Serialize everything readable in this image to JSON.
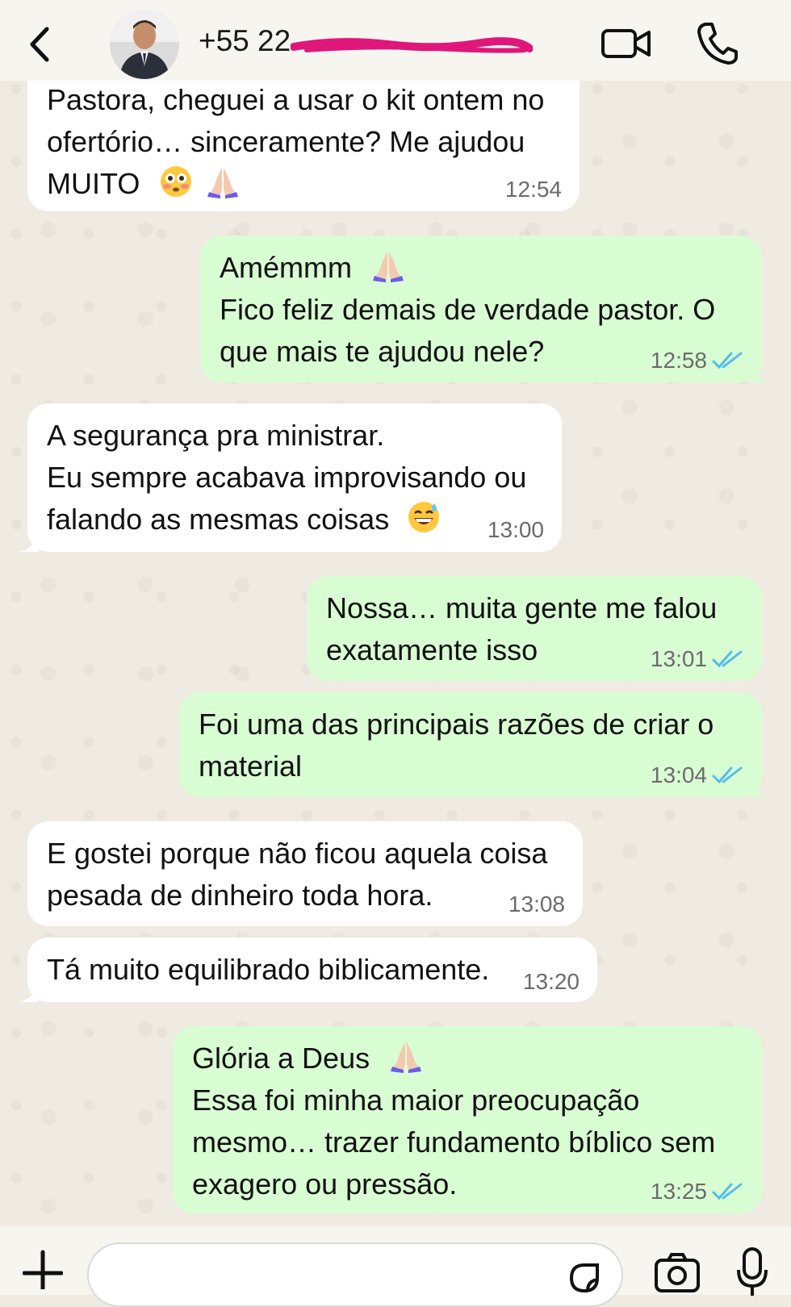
{
  "header": {
    "back_icon": "chevron-left-icon",
    "contact_name": "+55 22 ",
    "avatar_icon": "avatar",
    "video_icon": "video-camera-icon",
    "phone_icon": "phone-icon"
  },
  "messages": [
    {
      "direction": "incoming",
      "lines": [
        "Pastora, cheguei a usar o kit ontem no",
        "ofertório… sinceramente? Me ajudou",
        "MUITO"
      ],
      "emojis": [
        "flushed-face-emoji",
        "folded-hands-emoji"
      ],
      "time": "12:54"
    },
    {
      "direction": "outgoing",
      "lines": [
        "Amémmm",
        "Fico feliz demais de verdade pastor. O",
        "que mais te ajudou nele?"
      ],
      "emojis": [
        "folded-hands-emoji"
      ],
      "time": "12:58",
      "status": "read"
    },
    {
      "direction": "incoming",
      "lines": [
        "A segurança pra ministrar.",
        "Eu sempre acabava improvisando ou",
        "falando as mesmas coisas"
      ],
      "emojis": [
        "grinning-sweat-emoji"
      ],
      "time": "13:00"
    },
    {
      "direction": "outgoing",
      "lines": [
        "Nossa… muita gente me falou",
        "exatamente isso"
      ],
      "time": "13:01",
      "status": "read"
    },
    {
      "direction": "outgoing",
      "lines": [
        "Foi uma das principais razões de criar o",
        "material"
      ],
      "time": "13:04",
      "status": "read"
    },
    {
      "direction": "incoming",
      "lines": [
        "E gostei porque não ficou aquela coisa",
        "pesada de dinheiro toda hora."
      ],
      "time": "13:08"
    },
    {
      "direction": "incoming",
      "lines": [
        "Tá muito equilibrado biblicamente."
      ],
      "time": "13:20"
    },
    {
      "direction": "outgoing",
      "lines": [
        "Glória a Deus",
        "Essa foi minha maior preocupação",
        "mesmo… trazer fundamento bíblico sem",
        "exagero ou pressão."
      ],
      "emojis": [
        "folded-hands-emoji"
      ],
      "time": "13:25",
      "status": "read"
    }
  ],
  "input_bar": {
    "plus_icon": "plus-icon",
    "message_value": "",
    "sticker_icon": "sticker-icon",
    "camera_icon": "camera-icon",
    "mic_icon": "microphone-icon"
  },
  "colors": {
    "incoming_bubble": "#ffffff",
    "outgoing_bubble": "#d9fdd3",
    "chat_background": "#efeae2",
    "read_tick": "#53bdeb",
    "redaction": "#e0177a"
  }
}
